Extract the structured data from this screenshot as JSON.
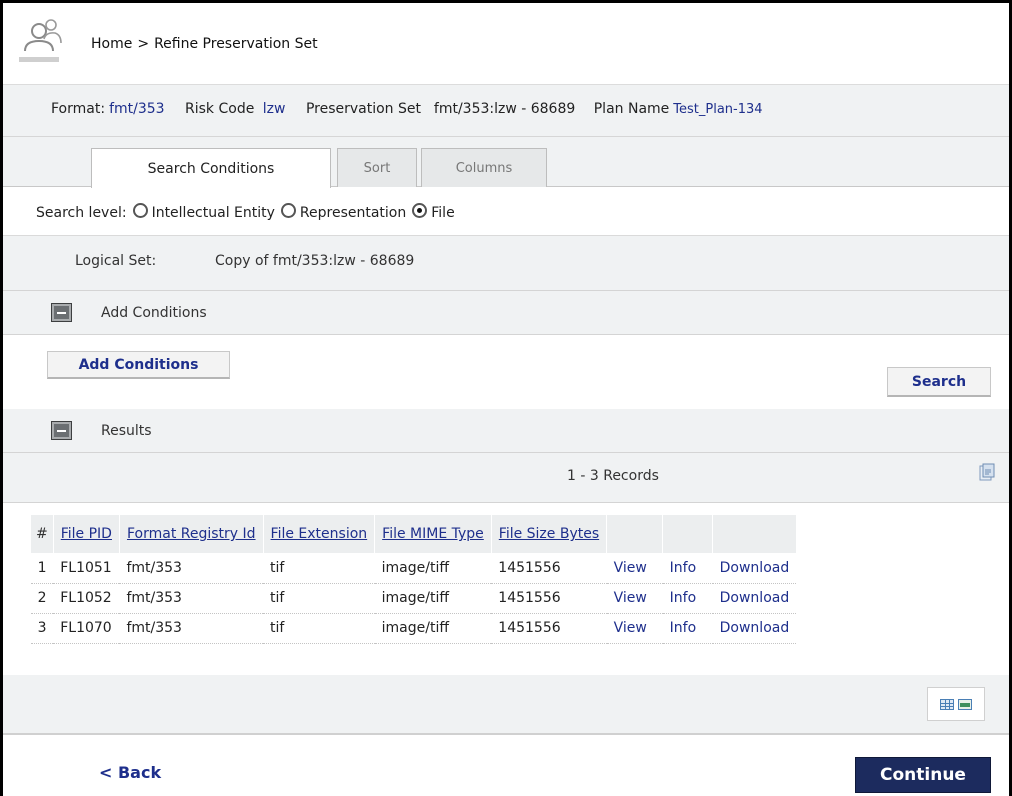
{
  "breadcrumb": {
    "home": "Home",
    "separator": ">",
    "current": "Refine Preservation Set"
  },
  "info": {
    "format_label": "Format:",
    "format_value": "fmt/353",
    "risk_label": "Risk Code",
    "risk_value": "lzw",
    "set_label": "Preservation Set",
    "set_value": "fmt/353:lzw - 68689",
    "plan_label": "Plan Name",
    "plan_value": "Test_Plan-134"
  },
  "tabs": [
    {
      "label": "Search Conditions",
      "active": true
    },
    {
      "label": "Sort",
      "active": false
    },
    {
      "label": "Columns",
      "active": false
    }
  ],
  "search_level": {
    "label": "Search level:",
    "options": [
      {
        "label": "Intellectual Entity",
        "selected": false
      },
      {
        "label": "Representation",
        "selected": false
      },
      {
        "label": "File",
        "selected": true
      }
    ]
  },
  "logical_set": {
    "label": "Logical Set:",
    "value": "Copy of fmt/353:lzw - 68689"
  },
  "add_conditions_section": {
    "title": "Add Conditions",
    "button": "Add Conditions"
  },
  "search_button": "Search",
  "results_section": {
    "title": "Results",
    "records": "1 - 3 Records"
  },
  "table": {
    "columns": [
      "#",
      "File PID",
      "Format Registry Id",
      "File Extension",
      "File MIME Type",
      "File Size Bytes",
      "",
      "",
      ""
    ],
    "rows": [
      {
        "num": "1",
        "pid": "FL1051",
        "format": "fmt/353",
        "ext": "tif",
        "mime": "image/tiff",
        "size": "1451556",
        "view": "View",
        "info": "Info",
        "download": "Download"
      },
      {
        "num": "2",
        "pid": "FL1052",
        "format": "fmt/353",
        "ext": "tif",
        "mime": "image/tiff",
        "size": "1451556",
        "view": "View",
        "info": "Info",
        "download": "Download"
      },
      {
        "num": "3",
        "pid": "FL1070",
        "format": "fmt/353",
        "ext": "tif",
        "mime": "image/tiff",
        "size": "1451556",
        "view": "View",
        "info": "Info",
        "download": "Download"
      }
    ]
  },
  "footer": {
    "back": "< Back",
    "continue": "Continue"
  },
  "icons": {
    "app": "users-icon",
    "export": "export-icon",
    "grid_view": "grid-view-icon",
    "list_view": "list-view-icon"
  },
  "colors": {
    "link": "#1e2f8c",
    "panel": "#f0f2f3",
    "continue_bg": "#1c2b5e"
  }
}
